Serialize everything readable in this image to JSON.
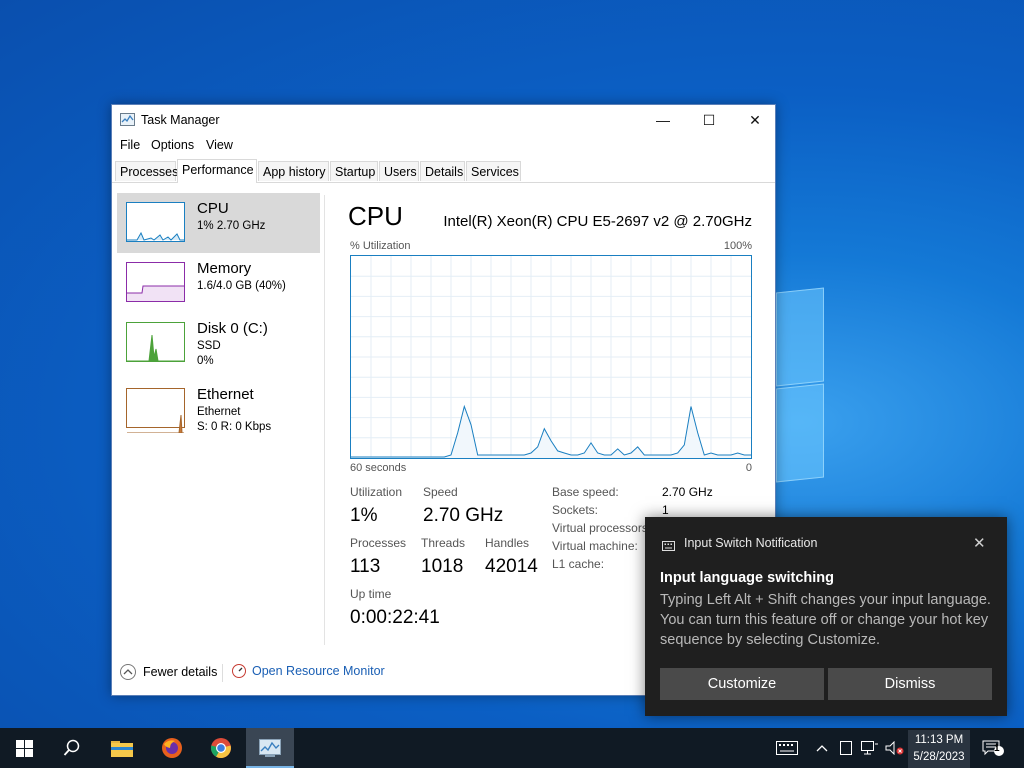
{
  "window": {
    "title": "Task Manager",
    "minimize_glyph": "—",
    "maximize_glyph": "☐",
    "close_glyph": "✕"
  },
  "menu": [
    "File",
    "Options",
    "View"
  ],
  "tabs": [
    "Processes",
    "Performance",
    "App history",
    "Startup",
    "Users",
    "Details",
    "Services"
  ],
  "active_tab": "Performance",
  "sidebar": [
    {
      "name": "CPU",
      "line1": "1% 2.70 GHz",
      "line2": "",
      "color": "#1a7fc1"
    },
    {
      "name": "Memory",
      "line1": "1.6/4.0 GB (40%)",
      "line2": "",
      "color": "#8b2ca8"
    },
    {
      "name": "Disk 0 (C:)",
      "line1": "SSD",
      "line2": "0%",
      "color": "#4ca23a"
    },
    {
      "name": "Ethernet",
      "line1": "Ethernet",
      "line2": "S: 0 R: 0 Kbps",
      "color": "#a5652b"
    }
  ],
  "cpu": {
    "title": "CPU",
    "model": "Intel(R) Xeon(R) CPU E5-2697 v2 @ 2.70GHz",
    "graph_label": "% Utilization",
    "graph_max": "100%",
    "graph_left": "60 seconds",
    "graph_right": "0",
    "utilization_label": "Utilization",
    "utilization": "1%",
    "speed_label": "Speed",
    "speed": "2.70 GHz",
    "processes_label": "Processes",
    "processes": "113",
    "threads_label": "Threads",
    "threads": "1018",
    "handles_label": "Handles",
    "handles": "42014",
    "uptime_label": "Up time",
    "uptime": "0:00:22:41",
    "details": [
      {
        "label": "Base speed:",
        "value": "2.70 GHz"
      },
      {
        "label": "Sockets:",
        "value": "1"
      },
      {
        "label": "Virtual processors:",
        "value": ""
      },
      {
        "label": "Virtual machine:",
        "value": ""
      },
      {
        "label": "L1 cache:",
        "value": ""
      }
    ]
  },
  "footer": {
    "fewer_details": "Fewer details",
    "open_resource_monitor": "Open Resource Monitor"
  },
  "toast": {
    "header": "Input Switch Notification",
    "close_glyph": "✕",
    "heading": "Input language switching",
    "body": "Typing Left Alt + Shift changes your input language. You can turn this feature off or change your hot key sequence by selecting Customize.",
    "customize": "Customize",
    "dismiss": "Dismiss"
  },
  "taskbar": {
    "time": "11:13 PM",
    "date": "5/28/2023",
    "notification_count": "1"
  },
  "chart_data": {
    "type": "area",
    "title": "",
    "ylabel": "% Utilization",
    "ylim": [
      0,
      100
    ],
    "x_seconds_ago": [
      60,
      59,
      58,
      57,
      56,
      55,
      54,
      53,
      52,
      51,
      50,
      49,
      48,
      47,
      46,
      45,
      44,
      43,
      42,
      41,
      40,
      39,
      38,
      37,
      36,
      35,
      34,
      33,
      32,
      31,
      30,
      29,
      28,
      27,
      26,
      25,
      24,
      23,
      22,
      21,
      20,
      19,
      18,
      17,
      16,
      15,
      14,
      13,
      12,
      11,
      10,
      9,
      8,
      7,
      6,
      5,
      4,
      3,
      2,
      1,
      0
    ],
    "values": [
      0,
      0,
      0,
      0,
      0,
      0,
      0,
      0,
      0,
      0,
      0,
      0,
      0,
      0,
      0,
      1,
      12,
      25,
      16,
      1,
      1,
      1,
      1,
      1,
      1,
      1,
      1,
      2,
      5,
      14,
      8,
      3,
      2,
      1,
      1,
      2,
      7,
      2,
      1,
      1,
      4,
      1,
      2,
      5,
      1,
      1,
      1,
      1,
      1,
      2,
      6,
      25,
      12,
      1,
      2,
      1,
      1,
      1,
      2,
      1,
      1
    ]
  }
}
